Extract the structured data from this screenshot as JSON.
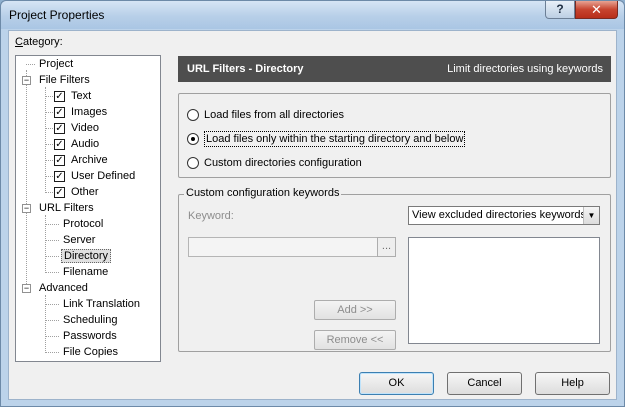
{
  "window": {
    "title": "Project Properties",
    "help_glyph": "?",
    "close_glyph": "✕"
  },
  "category": {
    "label_prefix": "C",
    "label_rest": "ategory:"
  },
  "tree": {
    "project": "Project",
    "file_filters": "File Filters",
    "file_children": [
      "Text",
      "Images",
      "Video",
      "Audio",
      "Archive",
      "User Defined",
      "Other"
    ],
    "url_filters": "URL Filters",
    "url_children": [
      "Protocol",
      "Server",
      "Directory",
      "Filename"
    ],
    "advanced": "Advanced",
    "advanced_children": [
      "Link Translation",
      "Scheduling",
      "Passwords",
      "File Copies"
    ]
  },
  "panel": {
    "title": "URL Filters - Directory",
    "description": "Limit directories using keywords"
  },
  "options": {
    "all_dirs": "Load files from all directories",
    "within_start": "Load files only within the starting directory and below",
    "custom": "Custom directories configuration",
    "selected": 1
  },
  "custom_group": {
    "legend": "Custom configuration keywords",
    "keyword_label": "Keyword:",
    "keyword_value": "",
    "browse_label": "...",
    "dropdown_value": "View excluded directories keywords",
    "add_label": "Add      >>",
    "remove_label": "Remove <<"
  },
  "buttons": {
    "ok": "OK",
    "cancel": "Cancel",
    "help": "Help"
  }
}
